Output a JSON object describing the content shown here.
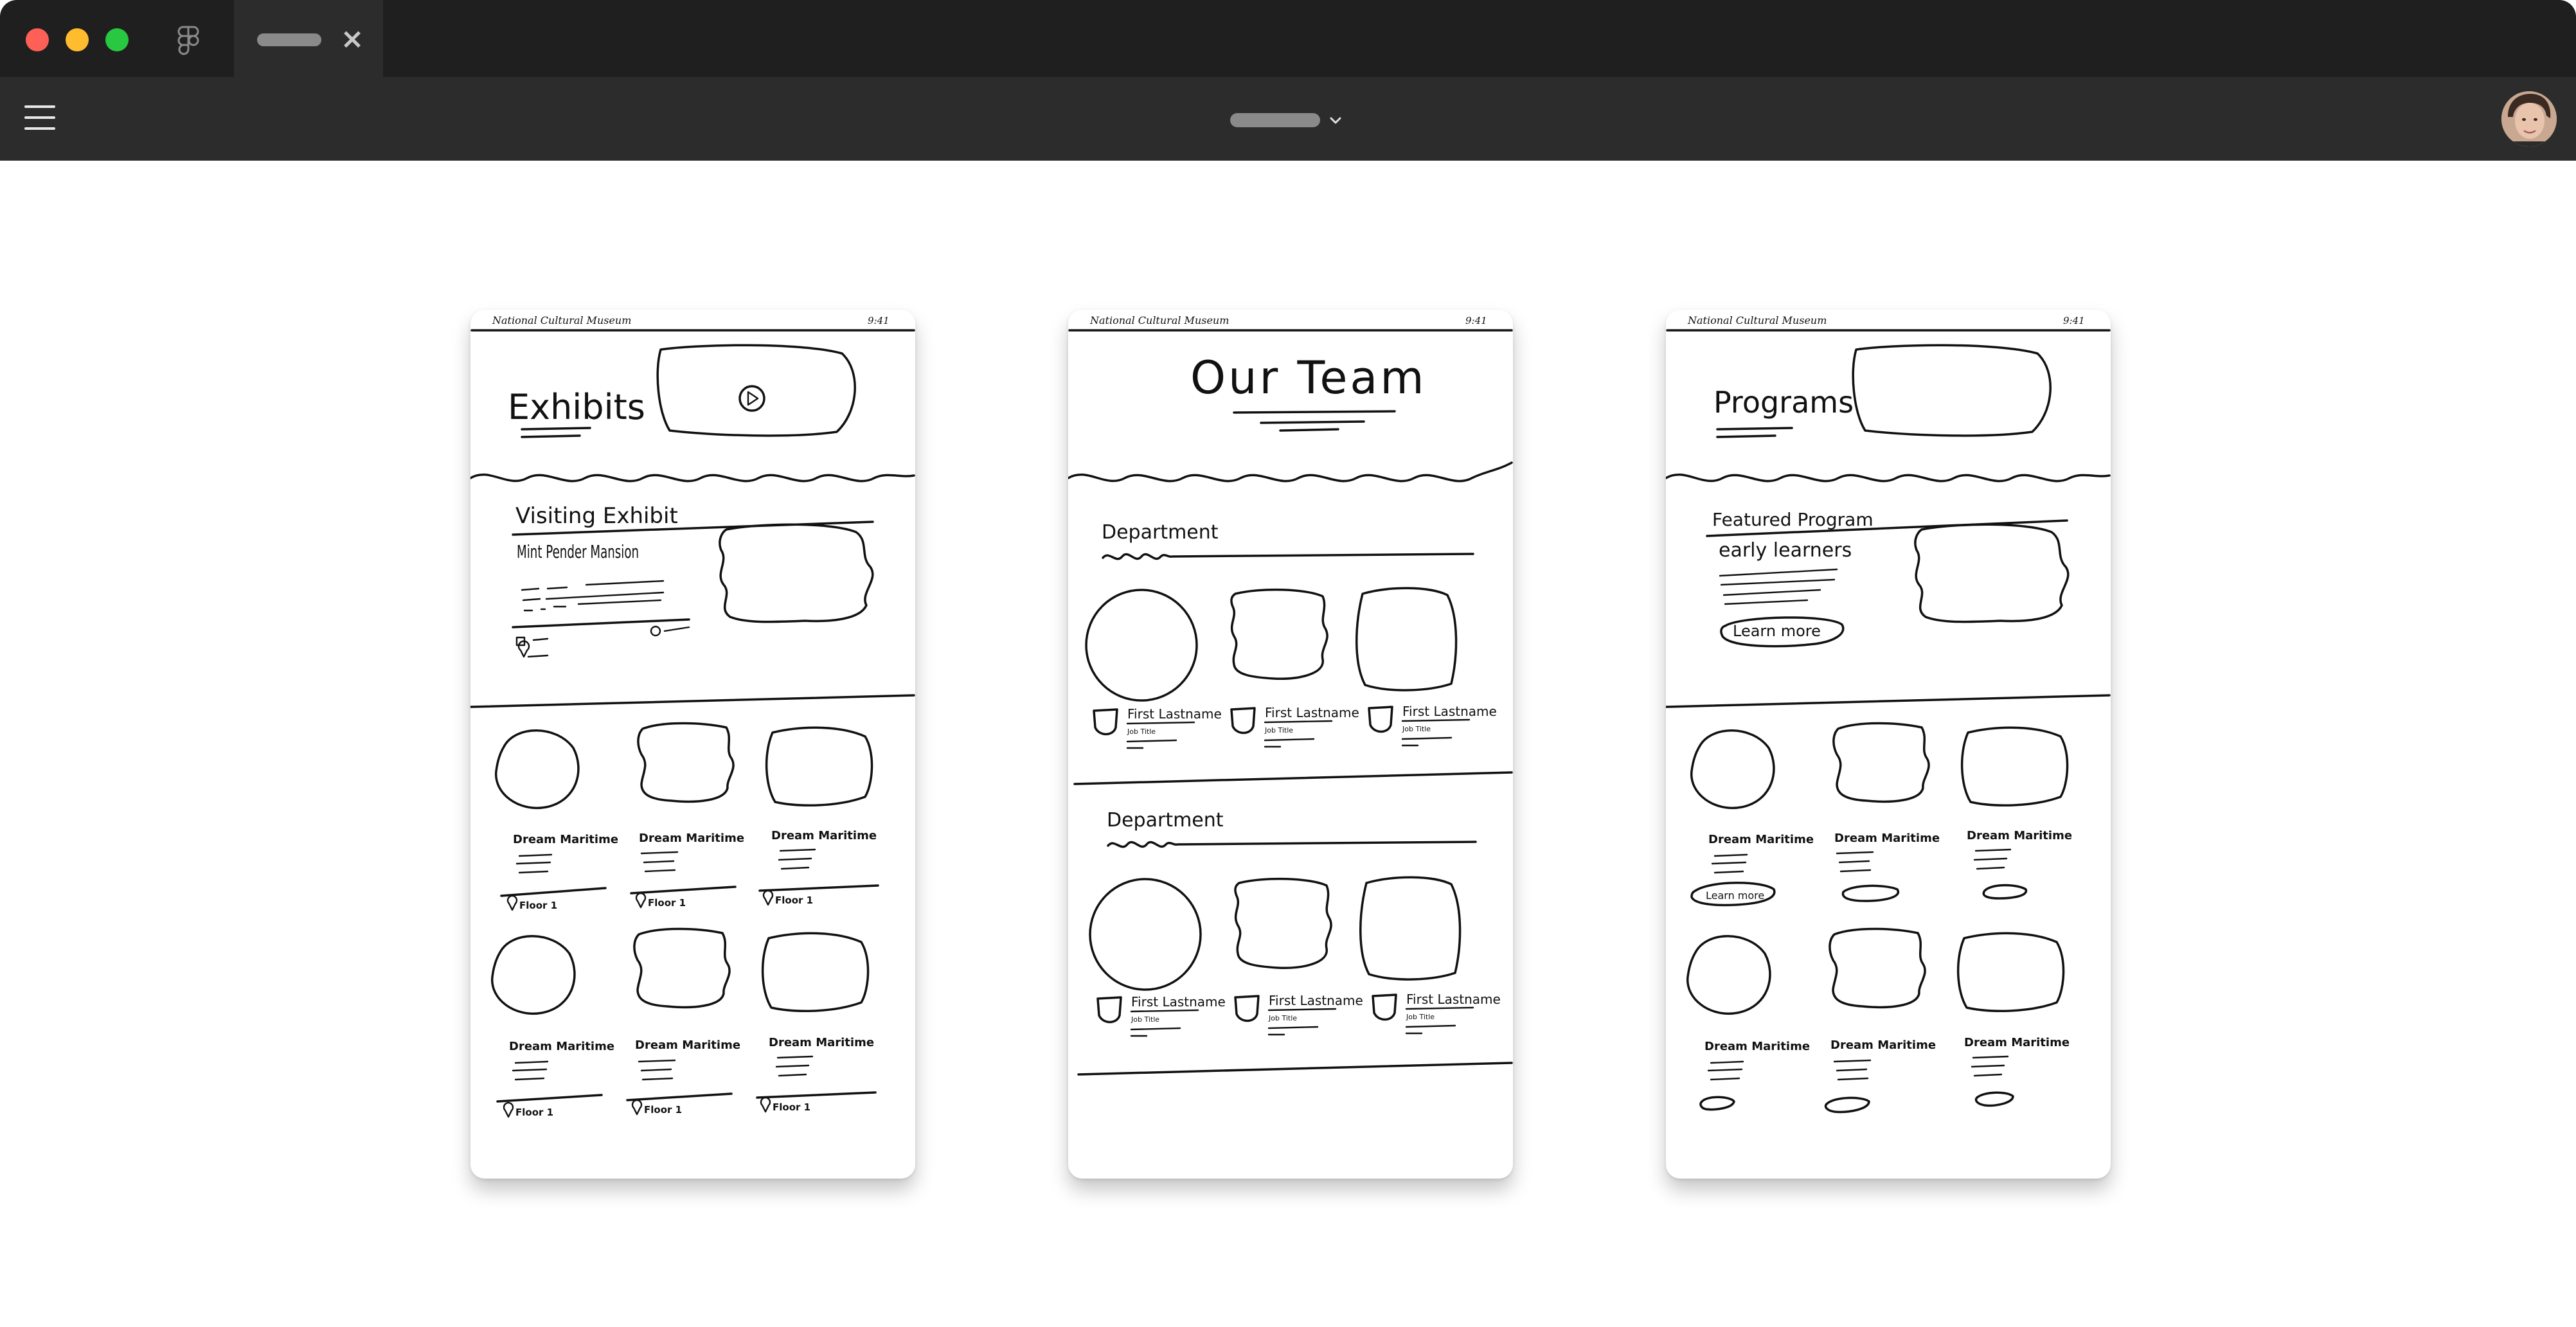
{
  "window": {
    "active_tab_close": "×"
  },
  "canvas": {
    "frames": [
      {
        "header_left": "National Cultural Museum",
        "header_right": "9:41",
        "title": "Exhibits",
        "section_title": "Visiting Exhibit",
        "exhibit_name": "Mint Pender Mansion",
        "card_title": "Dream Maritime",
        "card_meta": "Floor 1"
      },
      {
        "header_left": "National Cultural Museum",
        "header_right": "9:41",
        "title": "Our Team",
        "department_1": "Department",
        "department_2": "Department",
        "member_name": "First Lastname",
        "member_title": "Job Title"
      },
      {
        "header_left": "National Cultural Museum",
        "header_right": "9:41",
        "title": "Programs",
        "section_title": "Featured Program",
        "program_name": "early learners",
        "cta": "Learn more",
        "card_title": "Dream Maritime",
        "card_cta": "Learn more"
      }
    ]
  },
  "colors": {
    "titlebar": "#1f1f1f",
    "toolbar": "#2c2c2c",
    "close": "#fe5f57",
    "minimize": "#febc2e",
    "zoom": "#28c840"
  }
}
